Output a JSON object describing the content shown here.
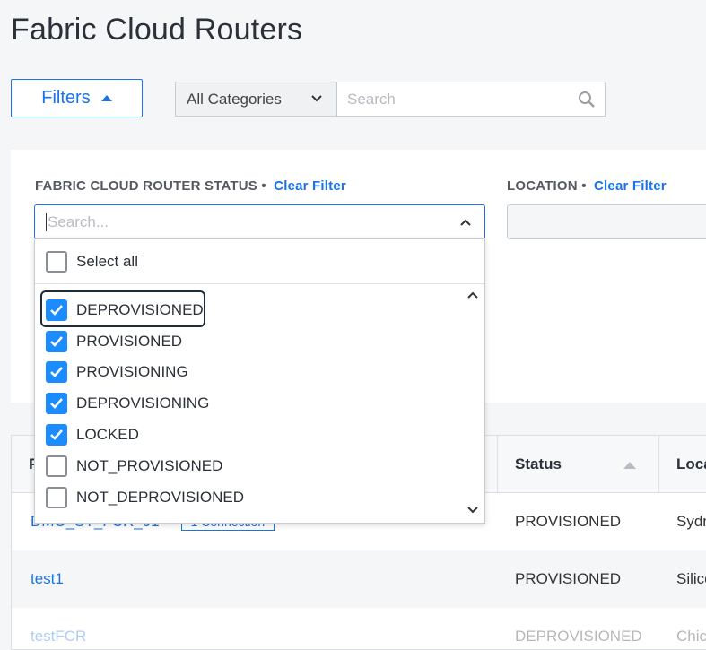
{
  "page": {
    "title": "Fabric Cloud Routers"
  },
  "toolbar": {
    "filters_label": "Filters",
    "category_value": "All Categories",
    "search_placeholder": "Search"
  },
  "filters": {
    "status": {
      "label": "FABRIC CLOUD ROUTER STATUS",
      "bullet": "•",
      "clear": "Clear Filter",
      "search_placeholder": "Search..."
    },
    "location": {
      "label": "LOCATION",
      "bullet": "•",
      "clear": "Clear Filter"
    }
  },
  "status_dropdown": {
    "select_all": "Select all",
    "options": [
      {
        "label": "DEPROVISIONED",
        "checked": true
      },
      {
        "label": "PROVISIONED",
        "checked": true
      },
      {
        "label": "PROVISIONING",
        "checked": true
      },
      {
        "label": "DEPROVISIONING",
        "checked": true
      },
      {
        "label": "LOCKED",
        "checked": true
      },
      {
        "label": "NOT_PROVISIONED",
        "checked": false
      },
      {
        "label": "NOT_DEPROVISIONED",
        "checked": false
      }
    ]
  },
  "table": {
    "columns": [
      "F",
      "Status",
      "Loca"
    ],
    "rows": [
      {
        "name": "DMO_ST_FCR_01",
        "tag": "1 Connection",
        "status": "PROVISIONED",
        "location": "Sydn"
      },
      {
        "name": "test1",
        "tag": "",
        "status": "PROVISIONED",
        "location": "Silico"
      },
      {
        "name": "testFCR",
        "tag": "",
        "status": "DEPROVISIONED",
        "location": "Chic"
      }
    ]
  },
  "colors": {
    "accent": "#1a73e8",
    "checkbox": "#1a8cff"
  }
}
